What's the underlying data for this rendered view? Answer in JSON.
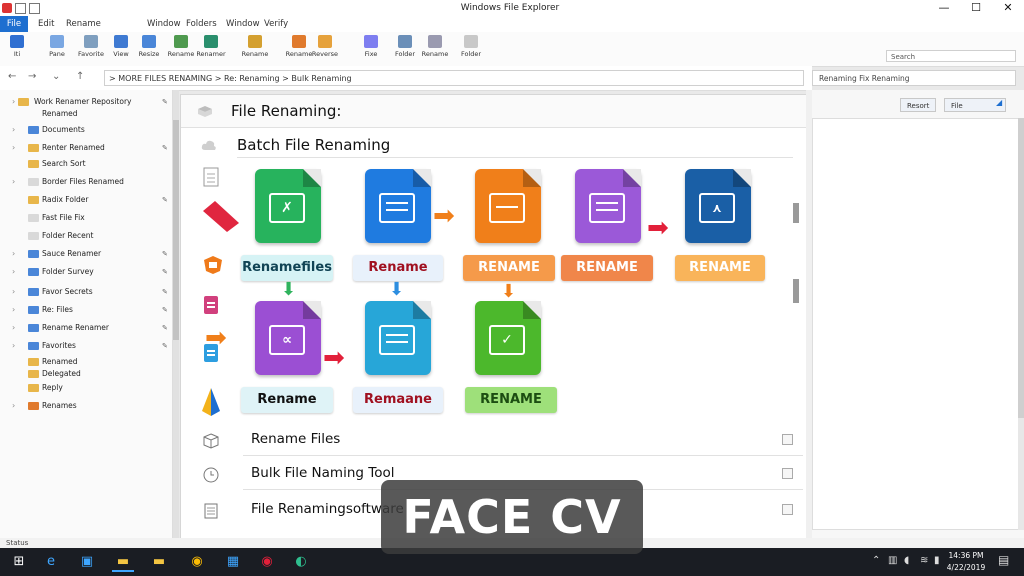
{
  "window": {
    "title": "Windows File Explorer",
    "controls": [
      "—",
      "☐",
      "✕"
    ]
  },
  "menu": {
    "items": [
      "File",
      "Edit",
      "Rename",
      "Window",
      "Folders",
      "Window",
      "Verify"
    ]
  },
  "ribbon": {
    "buttons": [
      {
        "label": "Iti",
        "color": "#2f6fd1"
      },
      {
        "label": "Pane",
        "color": "#7aa7e2"
      },
      {
        "label": "Favorite",
        "color": "#7f9fbf"
      },
      {
        "label": "View",
        "color": "#3f7ad2"
      },
      {
        "label": "Resize",
        "color": "#4a86d8"
      },
      {
        "label": "Rename",
        "color": "#4f9a4f"
      },
      {
        "label": "Renamer",
        "color": "#2a8f6d"
      },
      {
        "label": "Rename",
        "color": "#d4a030"
      },
      {
        "label": "Rename",
        "color": "#e07a2d"
      },
      {
        "label": "Reverse",
        "color": "#e6a23c"
      },
      {
        "label": "Fixe",
        "color": "#7e7ef0"
      },
      {
        "label": "Folder",
        "color": "#6b8fb8"
      },
      {
        "label": "Rename",
        "color": "#9a9ab0"
      },
      {
        "label": "Folder",
        "color": "#c8c8c8"
      }
    ],
    "search_placeholder": "Search"
  },
  "address": {
    "path": "> MORE FILES RENAMING > Re: Renaming > Bulk Renaming",
    "right_search": "Renaming Fix Renaming"
  },
  "nav_pane": {
    "items": [
      {
        "label": "Work Renamer Repository",
        "color": "#e8b64a"
      },
      {
        "label": "Renamed",
        "color": "#ffffff"
      },
      {
        "label": "Documents",
        "color": "#4a86d8"
      },
      {
        "label": "Renter Renamed",
        "color": "#e8b64a"
      },
      {
        "label": "Search Sort",
        "color": "#e8b64a"
      },
      {
        "label": "Border Files Renamed",
        "color": "#d9d9d9"
      },
      {
        "label": "Radix Folder",
        "color": "#e8b64a"
      },
      {
        "label": "Fast File Fix",
        "color": "#d9d9d9"
      },
      {
        "label": "Folder Recent",
        "color": "#d9d9d9"
      },
      {
        "label": "Sauce Renamer",
        "color": "#4a86d8"
      },
      {
        "label": "Folder Survey",
        "color": "#4a86d8"
      },
      {
        "label": "Favor Secrets",
        "color": "#4a86d8"
      },
      {
        "label": "Re: Files",
        "color": "#4a86d8"
      },
      {
        "label": "Rename Renamer",
        "color": "#4a86d8"
      },
      {
        "label": "Favorites",
        "color": "#4a86d8"
      },
      {
        "label": "Renamed",
        "color": "#e8b64a"
      },
      {
        "label": "Delegated",
        "color": "#e8b64a"
      },
      {
        "label": "Reply",
        "color": "#e8b64a"
      },
      {
        "label": "Renames",
        "color": "#e07a2d"
      }
    ]
  },
  "main": {
    "title": "File Renaming:",
    "subtitle": "Batch File Renaming",
    "flow_labels": [
      "Renamefiles",
      "Rename",
      "RENAME",
      "RENAME",
      "RENAME",
      "Rename",
      "Remaane",
      "RENAME"
    ],
    "list": [
      {
        "label": "Rename Files"
      },
      {
        "label": "Bulk File Naming Tool"
      },
      {
        "label": "File Renamingsoftware"
      }
    ]
  },
  "right_pane": {
    "buttons": [
      "Resort",
      "File"
    ]
  },
  "status": {
    "text": "Status"
  },
  "taskbar": {
    "time": "14:36 PM",
    "date": "4/22/2019"
  },
  "overlay": {
    "text": "FACE CV"
  }
}
